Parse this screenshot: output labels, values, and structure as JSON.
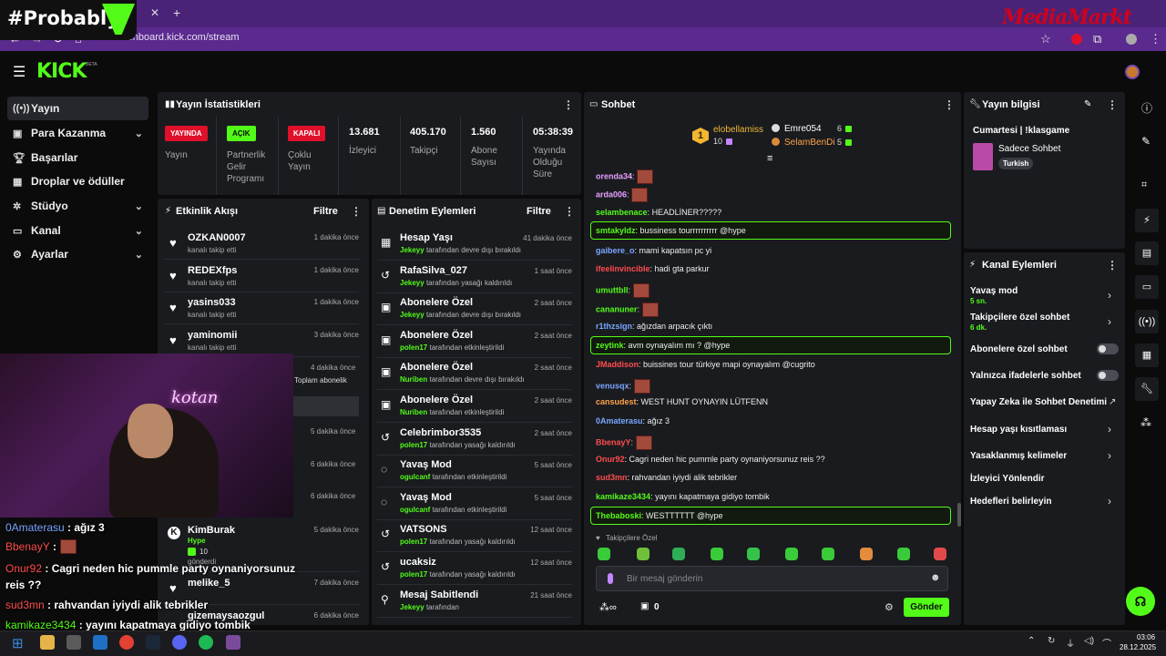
{
  "browser": {
    "brand_overlay": "#Probably",
    "watermark": "MediaMarkt",
    "url": "dashboard.kick.com/stream"
  },
  "kick": {
    "logo": "KICK",
    "beta": "BETA"
  },
  "sidebar": {
    "items": [
      {
        "label": "Yayın",
        "icon": "broadcast-icon"
      },
      {
        "label": "Para Kazanma",
        "icon": "money-icon"
      },
      {
        "label": "Başarılar",
        "icon": "trophy-icon"
      },
      {
        "label": "Droplar ve ödüller",
        "icon": "gift-icon"
      },
      {
        "label": "Stüdyo",
        "icon": "studio-icon"
      },
      {
        "label": "Kanal",
        "icon": "channel-icon"
      },
      {
        "label": "Ayarlar",
        "icon": "gear-icon"
      }
    ]
  },
  "stats": {
    "title": "Yayın İstatistikleri",
    "status": [
      {
        "badge": "YAYINDA",
        "label": "Yayın"
      },
      {
        "badge": "AÇIK",
        "label": "Partnerlik Gelir Programı"
      },
      {
        "badge": "KAPALI",
        "label": "Çoklu Yayın"
      }
    ],
    "metrics": [
      {
        "value": "13.681",
        "label": "İzleyici"
      },
      {
        "value": "405.170",
        "label": "Takipçi"
      },
      {
        "value": "1.560",
        "label": "Abone Sayısı"
      },
      {
        "value": "05:38:39",
        "label": "Yayında Olduğu Süre"
      }
    ]
  },
  "activity": {
    "title": "Etkinlik Akışı",
    "filter": "Filtre",
    "rows": [
      {
        "name": "OZKAN0007",
        "sub": "kanalı takip etti",
        "time": "1 dakika önce"
      },
      {
        "name": "REDEXfps",
        "sub": "kanalı takip etti",
        "time": "1 dakika önce"
      },
      {
        "name": "yasins033",
        "sub": "kanalı takip etti",
        "time": "1 dakika önce"
      },
      {
        "name": "yaminomii",
        "sub": "kanalı takip etti",
        "time": "3 dakika önce"
      }
    ],
    "partial_times": [
      "4 dakika önce",
      "5 dakika önce",
      "6 dakika önce",
      "6 dakika önce"
    ],
    "partial_sub": "Toplam abonelik",
    "hype": {
      "name": "KimBurak",
      "tag": "Hype",
      "count": "10",
      "sub": "gönderdi",
      "time": "5 dakika önce"
    },
    "extra": [
      {
        "name": "melike_5",
        "time": "7 dakika önce"
      },
      {
        "name": "gizemaysaozgul",
        "time": "6 dakika önce"
      }
    ]
  },
  "moderation": {
    "title": "Denetim Eylemleri",
    "filter": "Filtre",
    "rows": [
      {
        "name": "Hesap Yaşı",
        "mod": "Jekeyy",
        "action": "tarafından devre dışı bırakıldı",
        "time": "41 dakika önce",
        "icon": "calendar-icon"
      },
      {
        "name": "RafaSilva_027",
        "mod": "Jekeyy",
        "action": "tarafından yasağı kaldırıldı",
        "time": "1 saat önce",
        "icon": "undo-icon"
      },
      {
        "name": "Abonelere Özel",
        "mod": "Jekeyy",
        "action": "tarafından devre dışı bırakıldı",
        "time": "2 saat önce",
        "icon": "gift-icon"
      },
      {
        "name": "Abonelere Özel",
        "mod": "polen17",
        "action": "tarafından etkinleştirildi",
        "time": "2 saat önce",
        "icon": "gift-icon"
      },
      {
        "name": "Abonelere Özel",
        "mod": "Nuriben",
        "action": "tarafından devre dışı bırakıldı",
        "time": "2 saat önce",
        "icon": "gift-icon"
      },
      {
        "name": "Abonelere Özel",
        "mod": "Nuriben",
        "action": "tarafından etkinleştirildi",
        "time": "2 saat önce",
        "icon": "gift-icon"
      },
      {
        "name": "Celebrimbor3535",
        "mod": "polen17",
        "action": "tarafından yasağı kaldırıldı",
        "time": "2 saat önce",
        "icon": "undo-icon"
      },
      {
        "name": "Yavaş Mod",
        "mod": "ogulcanf",
        "action": "tarafından etkinleştirildi",
        "time": "5 saat önce",
        "icon": "snail-icon"
      },
      {
        "name": "Yavaş Mod",
        "mod": "ogulcanf",
        "action": "tarafından etkinleştirildi",
        "time": "5 saat önce",
        "icon": "snail-icon"
      },
      {
        "name": "VATSONS",
        "mod": "polen17",
        "action": "tarafından yasağı kaldırıldı",
        "time": "12 saat önce",
        "icon": "undo-icon"
      },
      {
        "name": "ucaksiz",
        "mod": "polen17",
        "action": "tarafından yasağı kaldırıldı",
        "time": "12 saat önce",
        "icon": "undo-icon"
      },
      {
        "name": "Mesaj Sabitlendi",
        "mod": "Jekeyy",
        "action": "tarafından",
        "time": "21 saat önce",
        "icon": "pin-icon"
      }
    ]
  },
  "chat": {
    "title": "Sohbet",
    "top_gifters": [
      {
        "rank": "1",
        "name": "elobellamiss",
        "count": "10"
      },
      {
        "name": "Emre054",
        "count": "6"
      },
      {
        "name": "SelamBenDi",
        "count": "5"
      }
    ],
    "messages": [
      {
        "user": "orenda34",
        "text": "",
        "color": "#e8a0ff",
        "emote": true
      },
      {
        "user": "arda006",
        "text": "",
        "color": "#e8a0ff",
        "emote": true
      },
      {
        "user": "selambenace",
        "text": "HEADLİNER?????",
        "color": "#53fc18"
      },
      {
        "user": "smtakyldz",
        "text": "bussiness tourrrrrrrrrr @hype",
        "color": "#53fc18",
        "highlight": true
      },
      {
        "user": "gaibere_o",
        "text": "mami kapatsın pc yi",
        "color": "#7aa7ff"
      },
      {
        "user": "ifeelinvincible",
        "text": "hadi gta parkur",
        "color": "#ff4d4d"
      },
      {
        "user": "umuttbll",
        "text": "",
        "color": "#53fc18",
        "emote": true
      },
      {
        "user": "cananuner",
        "text": "",
        "color": "#53fc18",
        "emote": true
      },
      {
        "user": "r1thzsign",
        "text": "ağızdan arpacık çıktı",
        "color": "#7aa7ff"
      },
      {
        "user": "zeytink",
        "text": "avm oynayalım mı ? @hype",
        "color": "#53fc18",
        "highlight": true
      },
      {
        "user": "JMaddison",
        "text": "buissines tour türkiye mapi oynayalım @cugrito",
        "color": "#ff4d4d"
      },
      {
        "user": "venusqx",
        "text": "",
        "color": "#7aa7ff",
        "emote": true
      },
      {
        "user": "cansudest",
        "text": "WEST HUNT OYNAYIN LÜTFENN",
        "color": "#ffa348"
      },
      {
        "user": "0Amaterasu",
        "text": "ağız 3",
        "color": "#7aa7ff"
      },
      {
        "user": "BbenayY",
        "text": "",
        "color": "#ff4d4d",
        "emote": true
      },
      {
        "user": "Onur92",
        "text": "Cagri neden hic pummle party oynaniyorsunuz reis ??",
        "color": "#ff4d4d"
      },
      {
        "user": "sud3mn",
        "text": "rahvandan iyiydi alik tebrikler",
        "color": "#ff4d4d"
      },
      {
        "user": "kamikaze3434",
        "text": "yayını kapatmaya gidiyo tombik",
        "color": "#53fc18"
      },
      {
        "user": "Thebaboski",
        "text": "WESTTTTTT @hype",
        "color": "#53fc18",
        "highlight": true
      }
    ],
    "section_label": "Takipçilere Özel",
    "input_placeholder": "Bir mesaj gönderin",
    "points": "0",
    "send_label": "Gönder"
  },
  "stream_info": {
    "title": "Yayın bilgisi",
    "stream_title": "Cumartesi | !klasgame",
    "category": "Sadece Sohbet",
    "tag": "Turkish"
  },
  "channel_actions": {
    "title": "Kanal Eylemleri",
    "items": [
      {
        "label": "Yavaş mod",
        "sub": "5 sn.",
        "control": "chevron"
      },
      {
        "label": "Takipçilere özel sohbet",
        "sub": "6 dk.",
        "control": "chevron"
      },
      {
        "label": "Abonelere özel sohbet",
        "control": "toggle",
        "on": false
      },
      {
        "label": "Yalnızca ifadelerle sohbet",
        "control": "toggle",
        "on": false
      },
      {
        "label": "Yapay Zeka ile Sohbet Denetimi",
        "control": "external"
      },
      {
        "label": "Hesap yaşı kısıtlaması",
        "control": "chevron"
      },
      {
        "label": "Yasaklanmış kelimeler",
        "control": "chevron"
      },
      {
        "label": "İzleyici Yönlendir",
        "control": "none"
      },
      {
        "label": "Hedefleri belirleyin",
        "control": "chevron"
      }
    ]
  },
  "overlay_chat": [
    {
      "user": "0Amaterasu",
      "text": ": ağız 3",
      "color": "#7aa7ff"
    },
    {
      "user": "BbenayY",
      "text": ":",
      "color": "#ff4d4d"
    },
    {
      "user": "Onur92",
      "text": ": Cagri neden hic pummle party oynaniyorsunuz",
      "color": "#ff4d4d"
    },
    {
      "user": "",
      "text": "reis ??",
      "color": "#ffffff"
    },
    {
      "user": "sud3mn",
      "text": ": rahvandan iyiydi alik tebrikler",
      "color": "#ff4d4d"
    },
    {
      "user": "kamikaze3434",
      "text": ": yayını kapatmaya gidiyo tombik",
      "color": "#53fc18"
    }
  ],
  "overlay_sign": "kotan",
  "taskbar": {
    "time": "03:06",
    "date": "28.12.2025"
  },
  "colors": {
    "accent": "#53fc18",
    "live": "#e0102a",
    "panel": "#191b1f",
    "browser": "#5a2a8e"
  }
}
